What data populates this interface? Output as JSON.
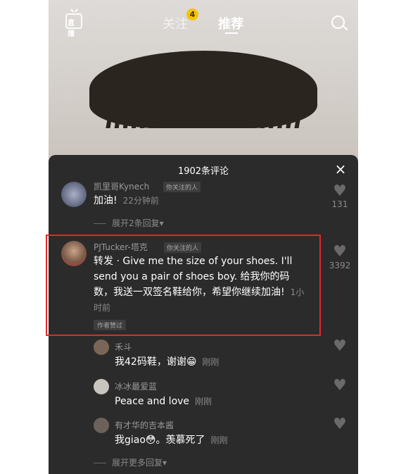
{
  "header": {
    "live_label": "直播",
    "tab_follow": "关注",
    "follow_badge": "4",
    "tab_recommend": "推荐"
  },
  "panel": {
    "title": "1902条评论",
    "close": "×"
  },
  "comments": [
    {
      "username": "凯里哥Kynech",
      "follow_tag": "你关注的人",
      "text": "加油!",
      "time": "22分钟前",
      "likes": "131",
      "expand": "展开2条回复▾"
    },
    {
      "username": "PJTucker-塔克",
      "follow_tag": "你关注的人",
      "text_prefix": "转发 · ",
      "text": "Give me the size of your shoes. I'll send you a pair of shoes boy. 给我你的码数，我送一双签名鞋给你，希望你继续加油!",
      "time": "1小时前",
      "author_tag": "作者赞过",
      "likes": "3392"
    }
  ],
  "replies": [
    {
      "username": "禾斗",
      "text": "我42码鞋，谢谢😁",
      "time": "刚刚"
    },
    {
      "username": "冰冰最爱蓝",
      "text": "Peace and love",
      "time": "刚刚"
    },
    {
      "username": "有才华的吉本酱",
      "text": "我giao😳。羡慕死了",
      "time": "刚刚"
    }
  ],
  "more_replies": "展开更多回复▾",
  "colors": {
    "accent_red": "#e0282e",
    "badge_yellow": "#f7c300"
  }
}
